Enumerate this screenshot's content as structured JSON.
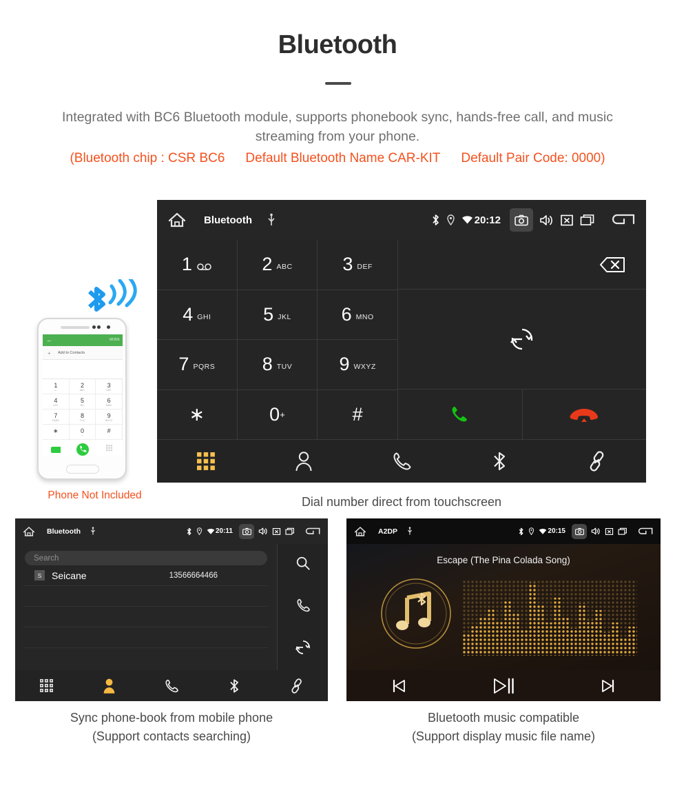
{
  "header": {
    "title": "Bluetooth",
    "subtitle": "Integrated with BC6 Bluetooth module, supports phonebook sync, hands-free call, and music streaming from your phone.",
    "spec_chip": "(Bluetooth chip : CSR BC6",
    "spec_name": "Default Bluetooth Name CAR-KIT",
    "spec_pair": "Default Pair Code: 0000)",
    "accent_color": "#f4511e",
    "subtitle_color": "#6f6f6f"
  },
  "phone_mockup": {
    "header_back": "←",
    "header_more": "MORE",
    "add_contacts": "Add to Contacts",
    "add_plus": "+",
    "keys": [
      {
        "n": "1",
        "s": "∞"
      },
      {
        "n": "2",
        "s": "ABC"
      },
      {
        "n": "3",
        "s": "DEF"
      },
      {
        "n": "4",
        "s": "GHI"
      },
      {
        "n": "5",
        "s": "JKL"
      },
      {
        "n": "6",
        "s": "MNO"
      },
      {
        "n": "7",
        "s": "PQRS"
      },
      {
        "n": "8",
        "s": "TUV"
      },
      {
        "n": "9",
        "s": "WXYZ"
      },
      {
        "n": "∗",
        "s": ","
      },
      {
        "n": "0",
        "s": "+"
      },
      {
        "n": "#",
        "s": ";"
      }
    ],
    "not_included": "Phone Not Included",
    "not_included_color": "#f4511e"
  },
  "dialer": {
    "statusbar": {
      "app_title": "Bluetooth",
      "time": "20:12",
      "icons": [
        "home-icon",
        "usb-icon",
        "bluetooth-icon",
        "location-icon",
        "wifi-icon",
        "camera-icon",
        "volume-icon",
        "close-icon",
        "recent-apps-icon",
        "back-icon"
      ]
    },
    "keys": [
      {
        "digit": "1",
        "sub": "",
        "icon": "voicemail-icon"
      },
      {
        "digit": "2",
        "sub": "ABC",
        "icon": ""
      },
      {
        "digit": "3",
        "sub": "DEF",
        "icon": ""
      },
      {
        "digit": "4",
        "sub": "GHI",
        "icon": ""
      },
      {
        "digit": "5",
        "sub": "JKL",
        "icon": ""
      },
      {
        "digit": "6",
        "sub": "MNO",
        "icon": ""
      },
      {
        "digit": "7",
        "sub": "PQRS",
        "icon": ""
      },
      {
        "digit": "8",
        "sub": "TUV",
        "icon": ""
      },
      {
        "digit": "9",
        "sub": "WXYZ",
        "icon": ""
      },
      {
        "digit": "∗",
        "sub": "",
        "icon": ""
      },
      {
        "digit": "0",
        "sub": "",
        "icon": "plus-superscript"
      },
      {
        "digit": "#",
        "sub": "",
        "icon": ""
      }
    ],
    "right_icons": {
      "backspace": "backspace-icon",
      "transfer": "audio-transfer-icon",
      "call": "call-answer-icon",
      "hangup": "call-end-icon"
    },
    "call_color": "#12c412",
    "hangup_color": "#e8391a",
    "navbar": [
      {
        "name": "keypad",
        "icon": "keypad-grid-icon",
        "active": true
      },
      {
        "name": "contacts",
        "icon": "contact-person-icon",
        "active": false
      },
      {
        "name": "call-log",
        "icon": "phone-handset-icon",
        "active": false
      },
      {
        "name": "bluetooth",
        "icon": "bluetooth-icon",
        "active": false
      },
      {
        "name": "link",
        "icon": "link-chain-icon",
        "active": false
      }
    ],
    "active_color": "#f5c04e",
    "caption": "Dial number direct from touchscreen"
  },
  "phonebook": {
    "statusbar": {
      "app_title": "Bluetooth",
      "time": "20:11"
    },
    "search_placeholder": "Search",
    "contacts": [
      {
        "badge": "S",
        "name": "Seicane",
        "number": "13566664466"
      }
    ],
    "side_icons": [
      "search-icon",
      "phone-handset-icon",
      "sync-icon"
    ],
    "navbar": [
      {
        "name": "keypad",
        "icon": "keypad-grid-icon",
        "active": false
      },
      {
        "name": "contacts",
        "icon": "contact-person-icon",
        "active": true
      },
      {
        "name": "call-log",
        "icon": "phone-handset-icon",
        "active": false
      },
      {
        "name": "bluetooth",
        "icon": "bluetooth-icon",
        "active": false
      },
      {
        "name": "link",
        "icon": "link-chain-icon",
        "active": false
      }
    ],
    "caption_line1": "Sync phone-book from mobile phone",
    "caption_line2": "(Support contacts searching)"
  },
  "music": {
    "statusbar": {
      "app_title": "A2DP",
      "time": "20:15"
    },
    "song_title": "Escape (The Pina Colada Song)",
    "controls": [
      "previous-track-icon",
      "play-pause-icon",
      "next-track-icon"
    ],
    "album_art_icon": "music-note-bluetooth-icon",
    "accent_color": "#d9a441",
    "caption_line1": "Bluetooth music compatible",
    "caption_line2": "(Support display music file name)"
  }
}
